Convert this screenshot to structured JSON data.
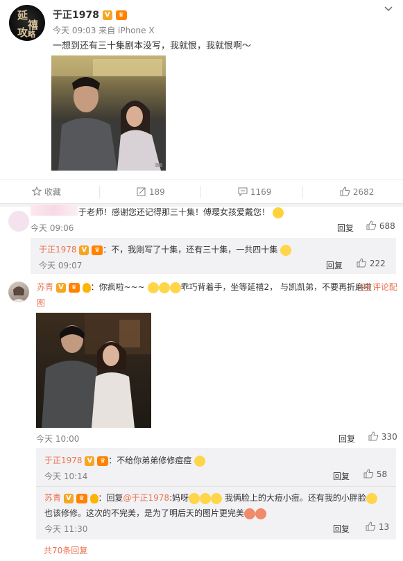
{
  "post": {
    "author": "于正1978",
    "time_source": "今天 09:03 来自 iPhone X",
    "text": "一想到还有三十集剧本没写，我就恨，我就恨啊～",
    "actions": {
      "fav": "收藏",
      "repost": "189",
      "comment": "1169",
      "like": "2682"
    }
  },
  "comments": [
    {
      "name": "于老师！感谢您还记得那三十集！傅璎女孩爱戴您！",
      "time": "今天 09:06",
      "reply": "回复",
      "likes": "688",
      "sub": {
        "name": "于正1978",
        "text": "：不，我刚写了十集，还有三十集，一共四十集",
        "time": "今天 09:07",
        "reply": "回复",
        "likes": "222"
      }
    },
    {
      "name": "苏青",
      "text": "：你疯啦~~~",
      "text2": "乖巧背着手，坐等延禧2， 与凯凯弟，不要再折磨啦",
      "img_link": "评论配",
      "img_link2": "图",
      "time": "今天 10:00",
      "reply": "回复",
      "likes": "330",
      "subs": [
        {
          "name": "于正1978",
          "text": "：不给你弟弟修修痘痘",
          "time": "今天 10:14",
          "reply": "回复",
          "likes": "58"
        },
        {
          "name": "苏青",
          "text_a": "：回复",
          "mention": "@于正1978",
          "text_b": ":妈呀",
          "text_c": " 我俩脸上的大痘小痘。还有我的小胖脸",
          "line2": "也该修修。这次的不完美，是为了明后天的图片更完美",
          "time": "今天 11:30",
          "reply": "回复",
          "likes": "13"
        }
      ],
      "more": "共70条回复"
    }
  ]
}
